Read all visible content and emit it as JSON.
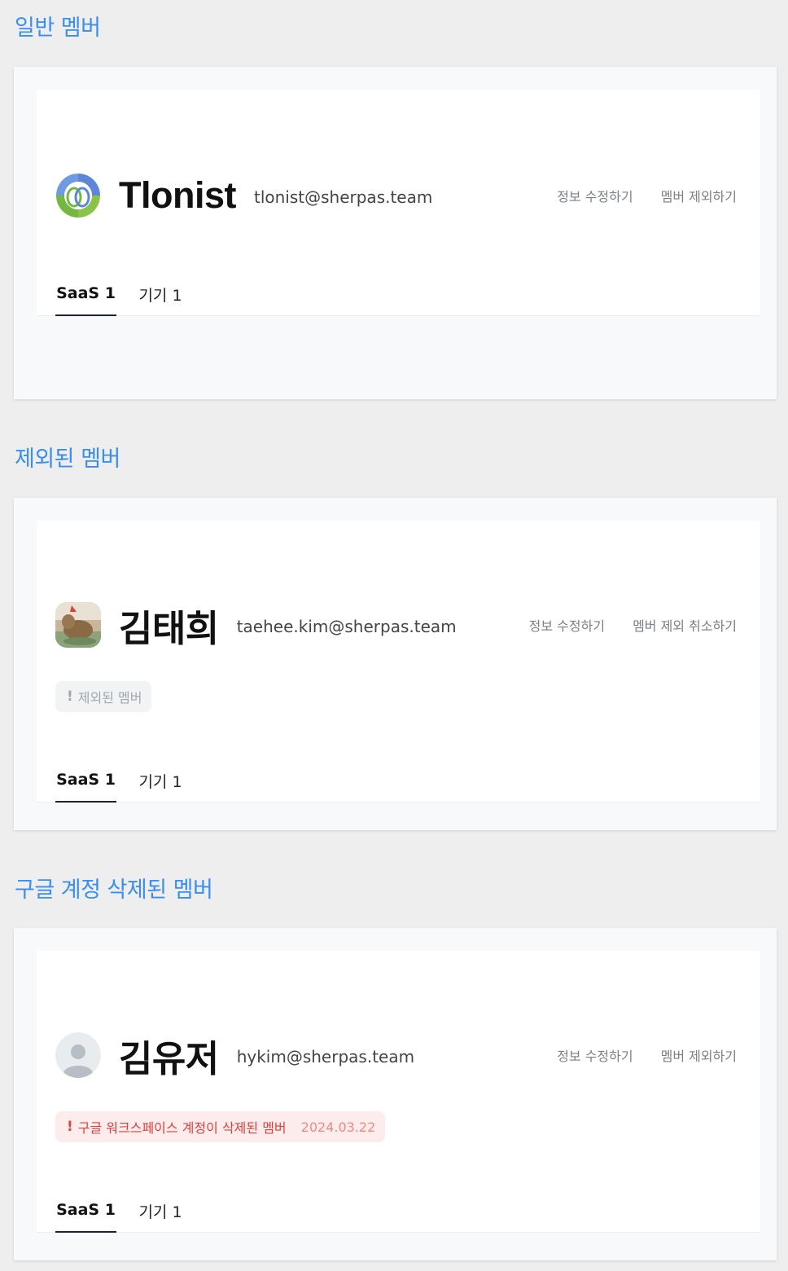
{
  "sections": [
    {
      "title": "일반 멤버",
      "member": {
        "name": "Tlonist",
        "email": "tlonist@sherpas.team",
        "avatar": "logo-icon"
      },
      "actions": [
        "정보 수정하기",
        "멤버 제외하기"
      ],
      "tabs": [
        "SaaS 1",
        "기기 1"
      ]
    },
    {
      "title": "제외된 멤버",
      "member": {
        "name": "김태희",
        "email": "taehee.kim@sherpas.team",
        "avatar": "photo"
      },
      "actions": [
        "정보 수정하기",
        "멤버 제외 취소하기"
      ],
      "badge": {
        "icon": "!",
        "text": "제외된 멤버"
      },
      "tabs": [
        "SaaS 1",
        "기기 1"
      ]
    },
    {
      "title": "구글 계정 삭제된 멤버",
      "member": {
        "name": "김유저",
        "email": "hykim@sherpas.team",
        "avatar": "default-user-icon"
      },
      "actions": [
        "정보 수정하기",
        "멤버 제외하기"
      ],
      "badge": {
        "icon": "!",
        "text": "구글 워크스페이스 계정이 삭제된 멤버",
        "date": "2024.03.22"
      },
      "tabs": [
        "SaaS 1",
        "기기 1"
      ]
    }
  ],
  "colors": {
    "section_title": "#3a8ef0",
    "page_bg": "#eeeeee",
    "badge_gray_text": "#a2a7ad",
    "badge_red_text": "#e0413f",
    "badge_red_bg": "#fdecec"
  }
}
